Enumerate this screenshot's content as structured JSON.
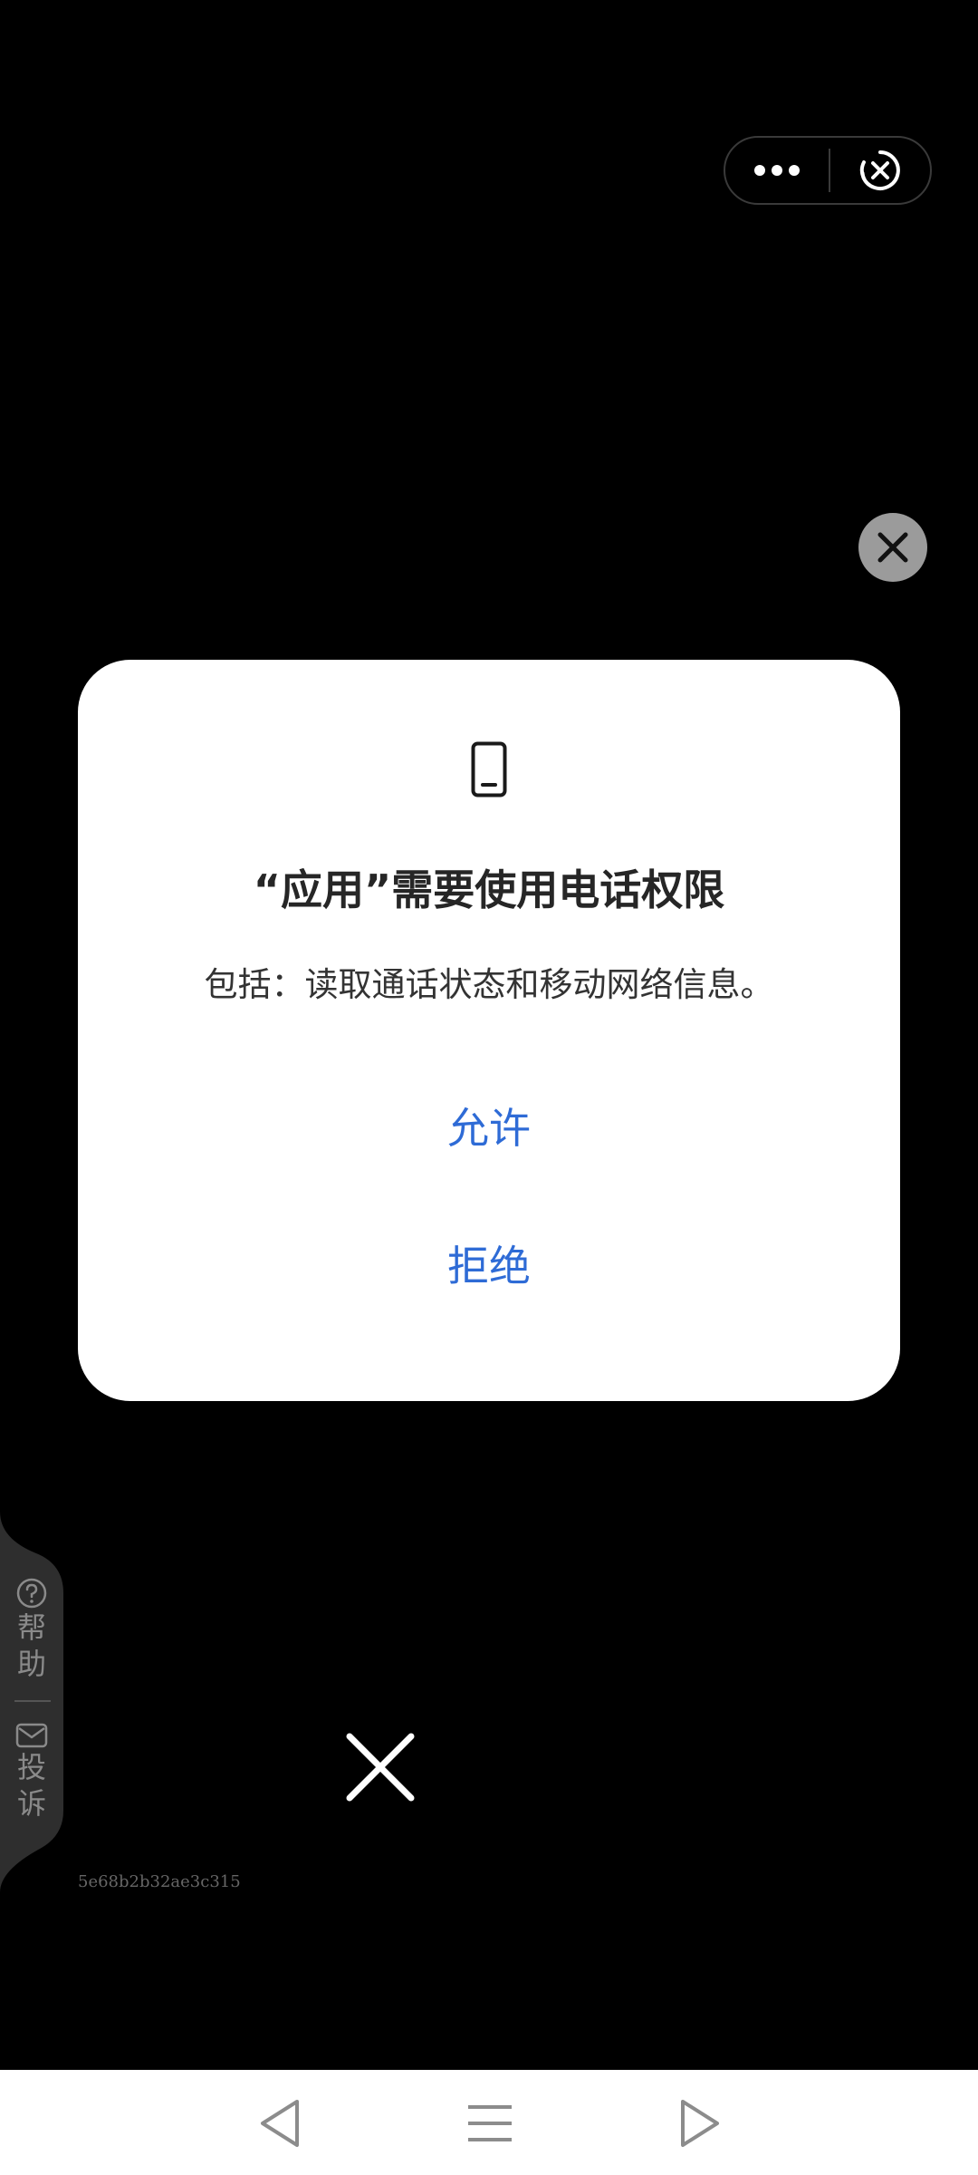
{
  "capsule": {
    "more_icon": "more-dots-icon",
    "close_icon": "close-circle-icon"
  },
  "ad": {
    "close_icon": "close-icon"
  },
  "dialog": {
    "icon": "phone-icon",
    "title": "“应用”需要使用电话权限",
    "description": "包括：读取通话状态和移动网络信息。",
    "allow_label": "允许",
    "deny_label": "拒绝"
  },
  "side_tab": {
    "help_icon": "question-circle-icon",
    "help_chars": [
      "帮",
      "助"
    ],
    "complain_icon": "mail-icon",
    "complain_chars": [
      "投",
      "诉"
    ]
  },
  "trace_id": "5e68b2b32ae3c315",
  "navbar": {
    "back_icon": "triangle-left-icon",
    "home_icon": "menu-lines-icon",
    "forward_icon": "triangle-right-icon"
  },
  "colors": {
    "background": "#000000",
    "dialog_bg": "#ffffff",
    "accent": "#2e6bd6",
    "ad_close_bg": "#9b9b9b"
  }
}
